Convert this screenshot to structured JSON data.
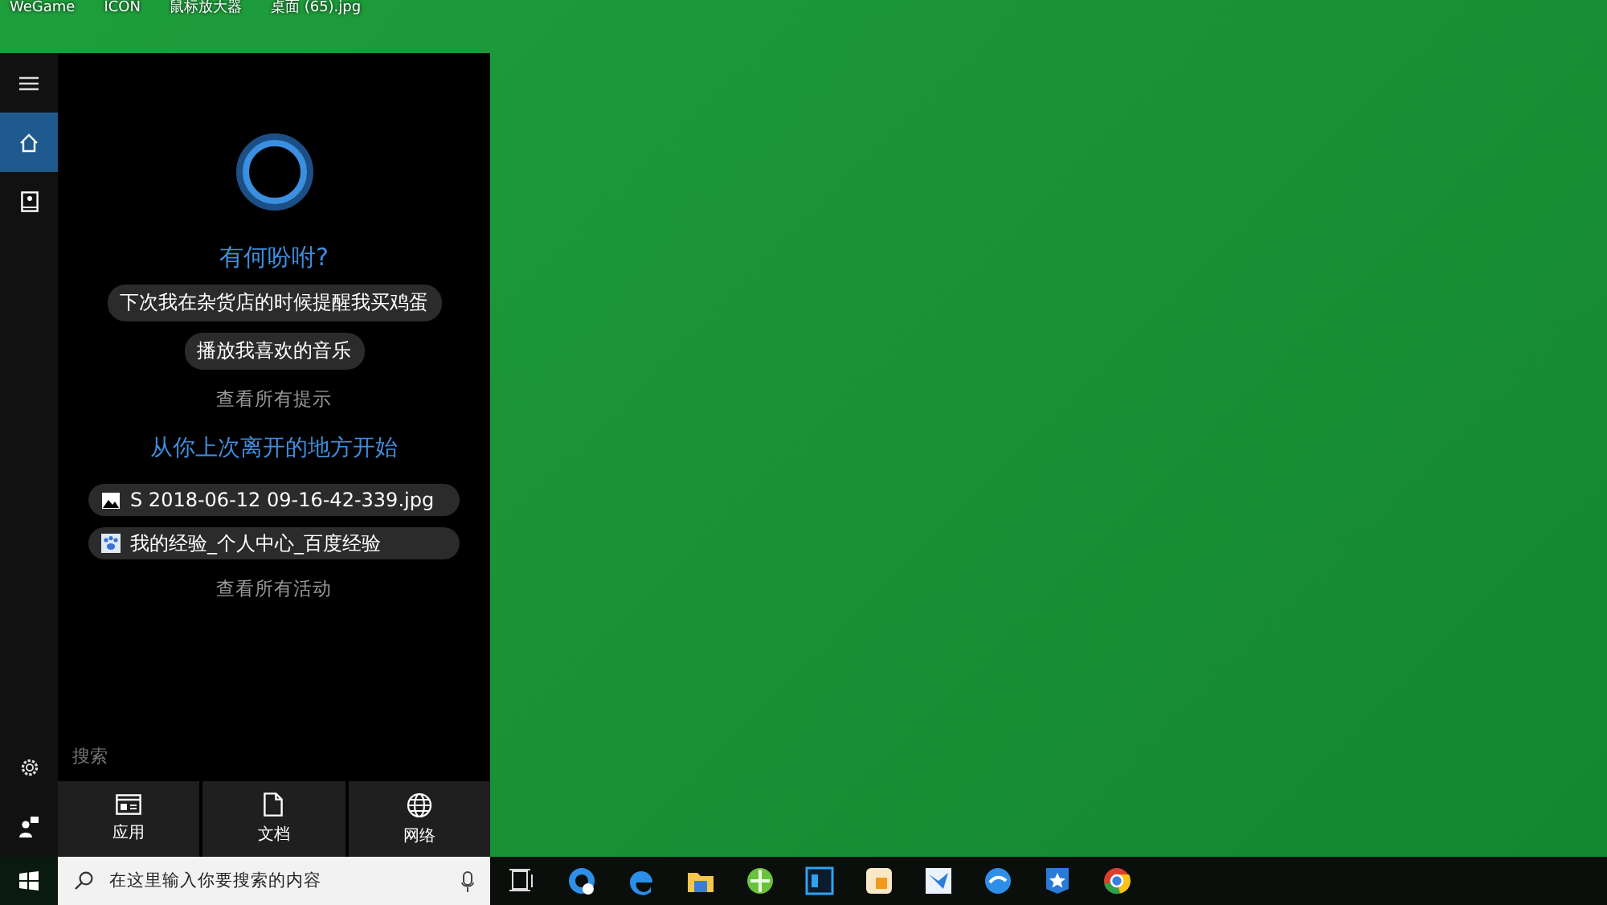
{
  "desktop_icons": [
    {
      "label": "WeGame"
    },
    {
      "label": "ICON"
    },
    {
      "label": "鼠标放大器"
    },
    {
      "label": "桌面 (65).jpg"
    }
  ],
  "cortana": {
    "sidebar": [
      {
        "kind": "home",
        "selected": true
      },
      {
        "kind": "notebook",
        "selected": false
      }
    ],
    "prompt": "有何吩咐?",
    "suggestions": [
      "下次我在杂货店的时候提醒我买鸡蛋",
      "播放我喜欢的音乐"
    ],
    "see_all_tips": "查看所有提示",
    "resume_heading": "从你上次离开的地方开始",
    "recent": [
      {
        "kind": "image",
        "name": "S 2018-06-12 09-16-42-339.jpg"
      },
      {
        "kind": "web",
        "name": "我的经验_个人中心_百度经验"
      }
    ],
    "see_all_activity": "查看所有活动",
    "search_label": "搜索",
    "filters": [
      {
        "kind": "apps",
        "label": "应用"
      },
      {
        "kind": "documents",
        "label": "文档"
      },
      {
        "kind": "web",
        "label": "网络"
      }
    ]
  },
  "taskbar": {
    "search": {
      "placeholder": "在这里输入你要搜索的内容"
    }
  }
}
